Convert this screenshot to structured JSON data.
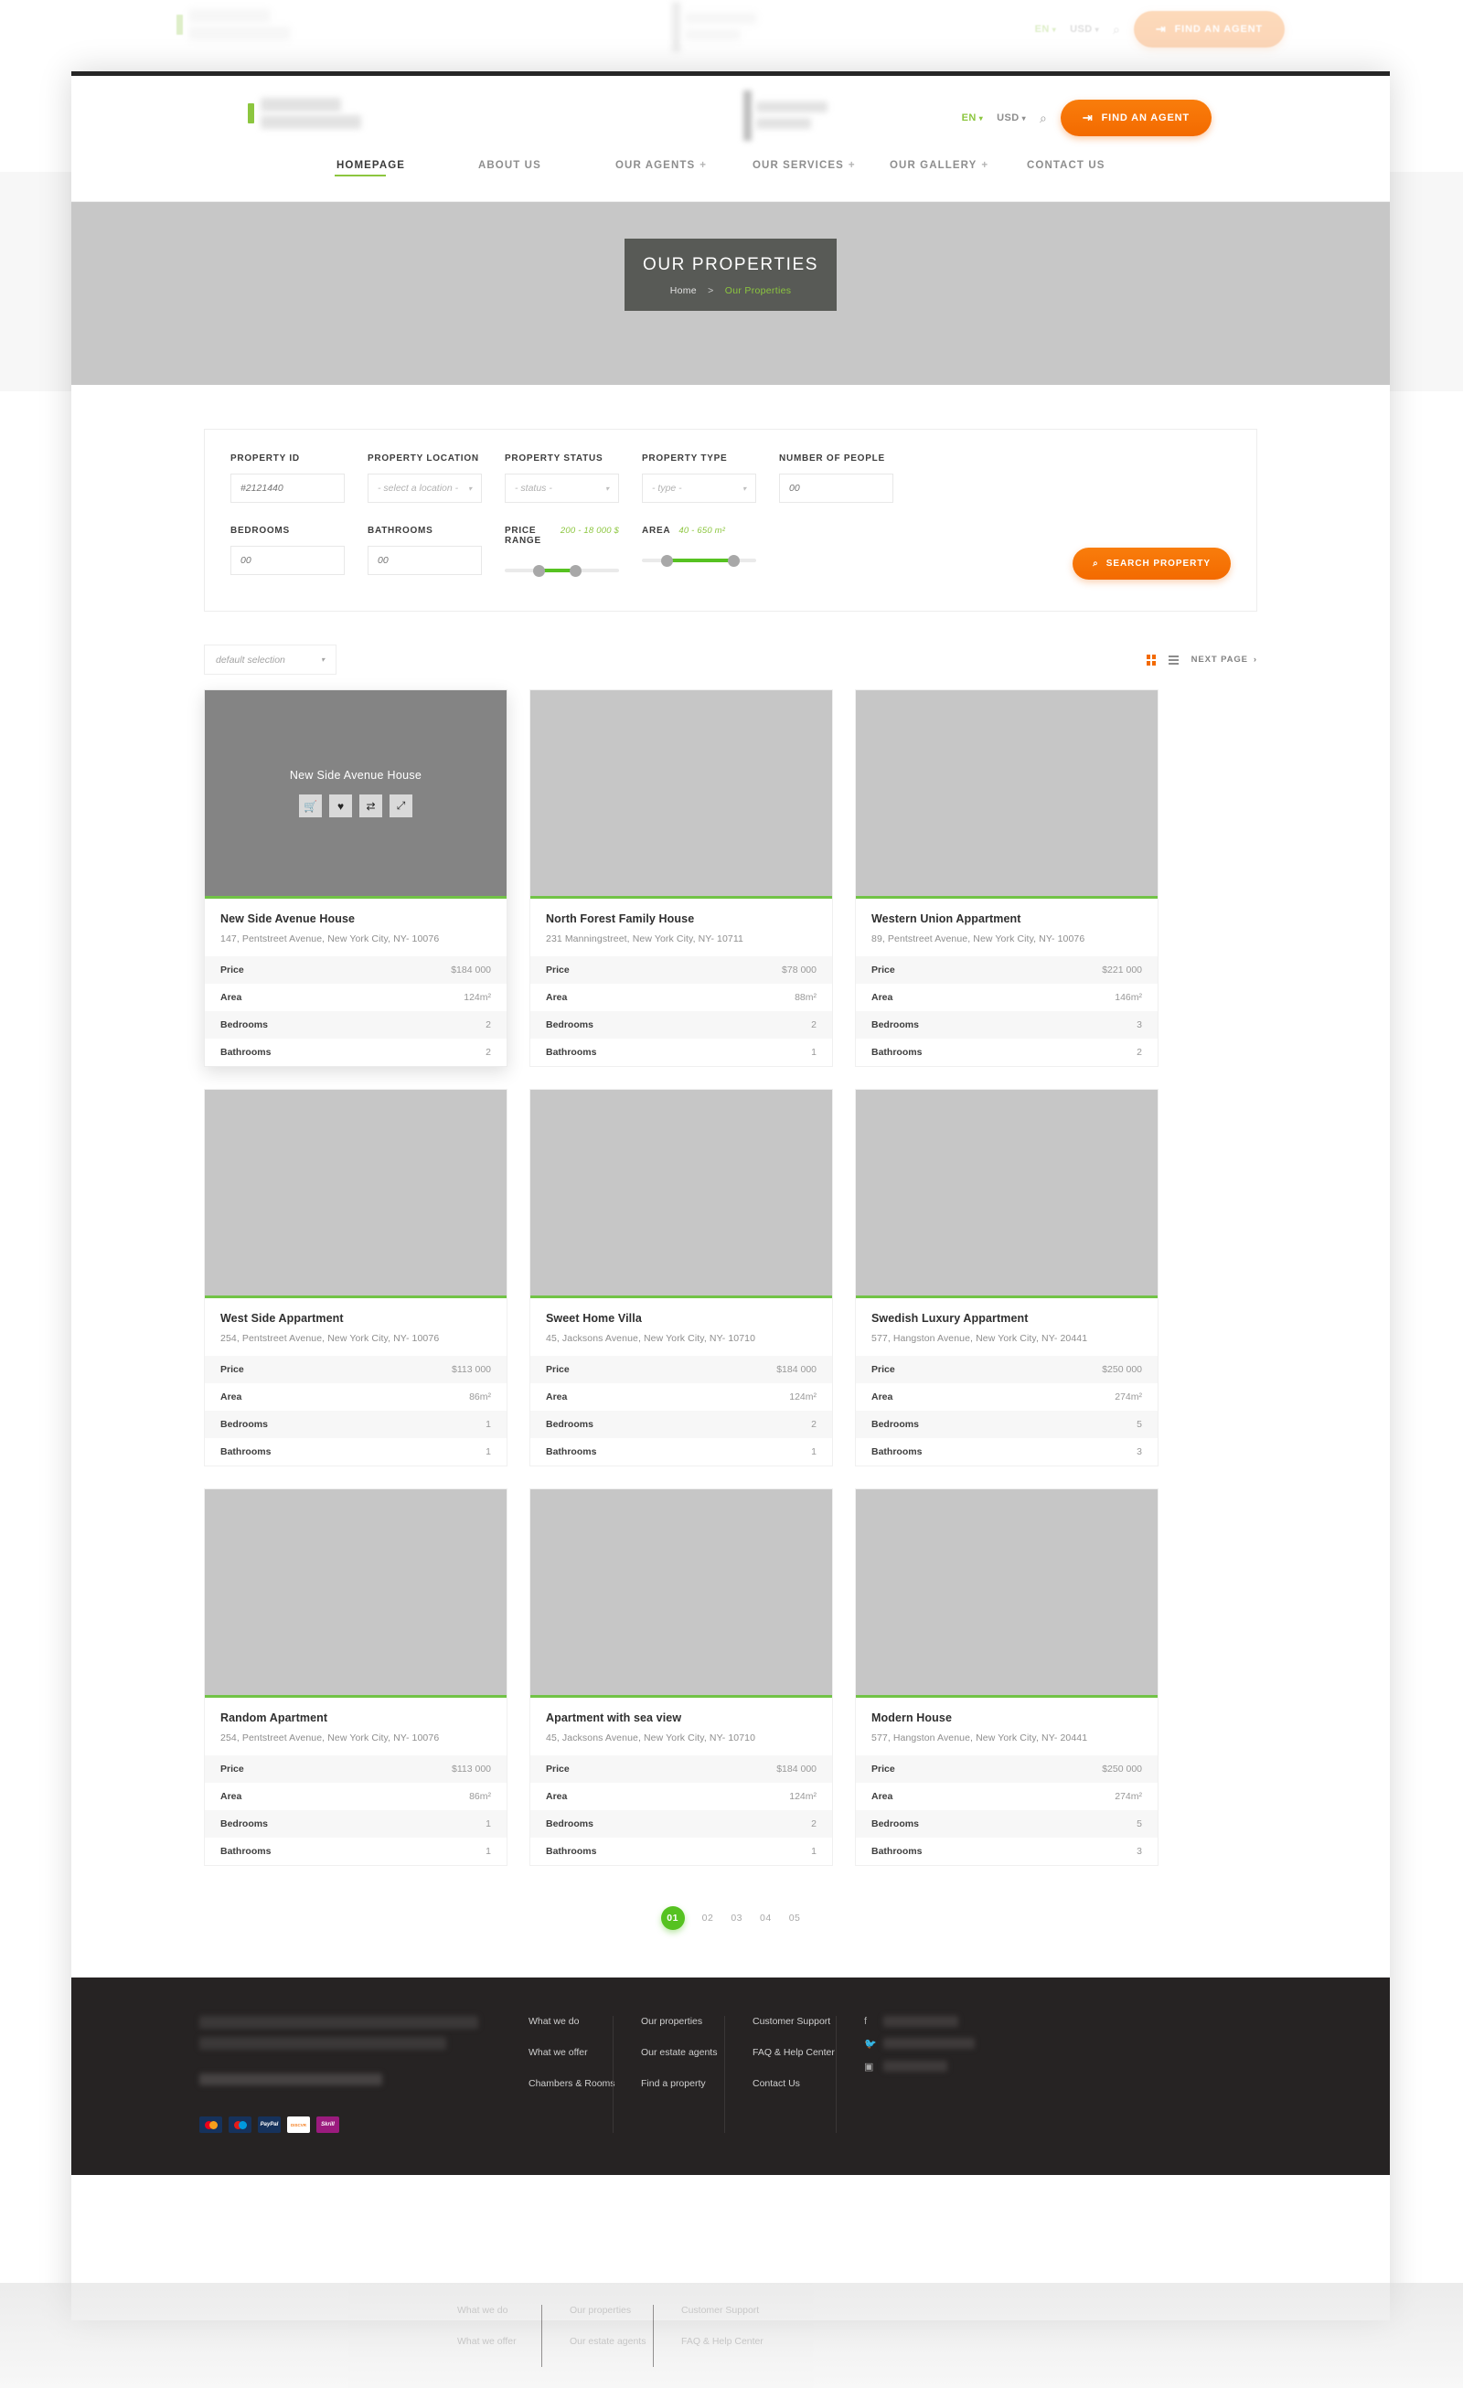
{
  "header": {
    "language": "EN",
    "currency": "USD",
    "search_icon": "search-icon",
    "find_agent_button": "FIND AN AGENT",
    "nav": [
      {
        "label": "HOMEPAGE",
        "active": true,
        "has_submenu": false
      },
      {
        "label": "ABOUT US",
        "active": false,
        "has_submenu": false
      },
      {
        "label": "OUR AGENTS",
        "active": false,
        "has_submenu": true
      },
      {
        "label": "OUR SERVICES",
        "active": false,
        "has_submenu": true
      },
      {
        "label": "OUR GALLERY",
        "active": false,
        "has_submenu": true
      },
      {
        "label": "CONTACT US",
        "active": false,
        "has_submenu": false
      }
    ]
  },
  "banner": {
    "title": "OUR PROPERTIES",
    "crumb_home": "Home",
    "crumb_sep": ">",
    "crumb_current": "Our Properties"
  },
  "filters": {
    "property_id": {
      "label": "PROPERTY ID",
      "placeholder": "#2121440",
      "value": ""
    },
    "property_location": {
      "label": "PROPERTY LOCATION",
      "value": "- select a location -"
    },
    "property_status": {
      "label": "PROPERTY STATUS",
      "value": "- status -"
    },
    "property_type": {
      "label": "PROPERTY TYPE",
      "value": "- type -"
    },
    "number_of_people": {
      "label": "NUMBER OF PEOPLE",
      "placeholder": "00",
      "value": ""
    },
    "bedrooms": {
      "label": "BEDROOMS",
      "placeholder": "00",
      "value": ""
    },
    "bathrooms": {
      "label": "BATHROOMS",
      "placeholder": "00",
      "value": ""
    },
    "price_range": {
      "label": "PRICE RANGE",
      "value": "200 - 18 000 $",
      "min_pct": 30,
      "max_pct": 62
    },
    "area": {
      "label": "AREA",
      "value": "40 - 650 m²",
      "min_pct": 22,
      "max_pct": 80
    },
    "search_button": "SEARCH PROPERTY"
  },
  "toolbar": {
    "sort_value": "default selection",
    "grid_view_icon": "grid-view-icon",
    "list_view_icon": "list-view-icon",
    "next_page": "NEXT PAGE"
  },
  "card_spec_labels": {
    "price": "Price",
    "area": "Area",
    "bedrooms": "Bedrooms",
    "bathrooms": "Bathrooms"
  },
  "hover_actions": [
    "cart-icon",
    "heart-icon",
    "compare-icon",
    "expand-icon"
  ],
  "properties": [
    {
      "title": "New Side Avenue House",
      "address": "147, Pentstreet Avenue, New York City, NY- 10076",
      "price": "$184 000",
      "area": "124m²",
      "bedrooms": "2",
      "bathrooms": "2",
      "hovered": true
    },
    {
      "title": "North Forest Family House",
      "address": "231 Manningstreet, New York City, NY- 10711",
      "price": "$78 000",
      "area": "88m²",
      "bedrooms": "2",
      "bathrooms": "1",
      "hovered": false
    },
    {
      "title": "Western Union Appartment",
      "address": "89, Pentstreet Avenue, New York City, NY- 10076",
      "price": "$221 000",
      "area": "146m²",
      "bedrooms": "3",
      "bathrooms": "2",
      "hovered": false
    },
    {
      "title": "West Side Appartment",
      "address": "254, Pentstreet Avenue, New York City, NY- 10076",
      "price": "$113 000",
      "area": "86m²",
      "bedrooms": "1",
      "bathrooms": "1",
      "hovered": false
    },
    {
      "title": "Sweet Home Villa",
      "address": "45, Jacksons Avenue, New York City, NY- 10710",
      "price": "$184 000",
      "area": "124m²",
      "bedrooms": "2",
      "bathrooms": "1",
      "hovered": false
    },
    {
      "title": "Swedish Luxury Appartment",
      "address": "577, Hangston Avenue, New York City, NY- 20441",
      "price": "$250 000",
      "area": "274m²",
      "bedrooms": "5",
      "bathrooms": "3",
      "hovered": false
    },
    {
      "title": "Random Apartment",
      "address": "254, Pentstreet Avenue, New York City, NY- 10076",
      "price": "$113 000",
      "area": "86m²",
      "bedrooms": "1",
      "bathrooms": "1",
      "hovered": false
    },
    {
      "title": "Apartment with sea view",
      "address": "45, Jacksons Avenue, New York City, NY- 10710",
      "price": "$184 000",
      "area": "124m²",
      "bedrooms": "2",
      "bathrooms": "1",
      "hovered": false
    },
    {
      "title": "Modern House",
      "address": "577, Hangston Avenue, New York City, NY- 20441",
      "price": "$250 000",
      "area": "274m²",
      "bedrooms": "5",
      "bathrooms": "3",
      "hovered": false
    }
  ],
  "pagination": {
    "pages": [
      "01",
      "02",
      "03",
      "04",
      "05"
    ],
    "active": "01"
  },
  "footer": {
    "columns": [
      {
        "links": [
          "What we do",
          "What we offer",
          "Chambers & Rooms"
        ]
      },
      {
        "links": [
          "Our properties",
          "Our estate agents",
          "Find a property"
        ]
      },
      {
        "links": [
          "Customer Support",
          "FAQ & Help Center",
          "Contact Us"
        ]
      }
    ],
    "social_icons": [
      "facebook-icon",
      "twitter-icon",
      "instagram-icon"
    ],
    "payment_methods": [
      "mastercard-icon",
      "maestro-icon",
      "paypal-icon",
      "discover-icon",
      "skrill-icon"
    ]
  }
}
